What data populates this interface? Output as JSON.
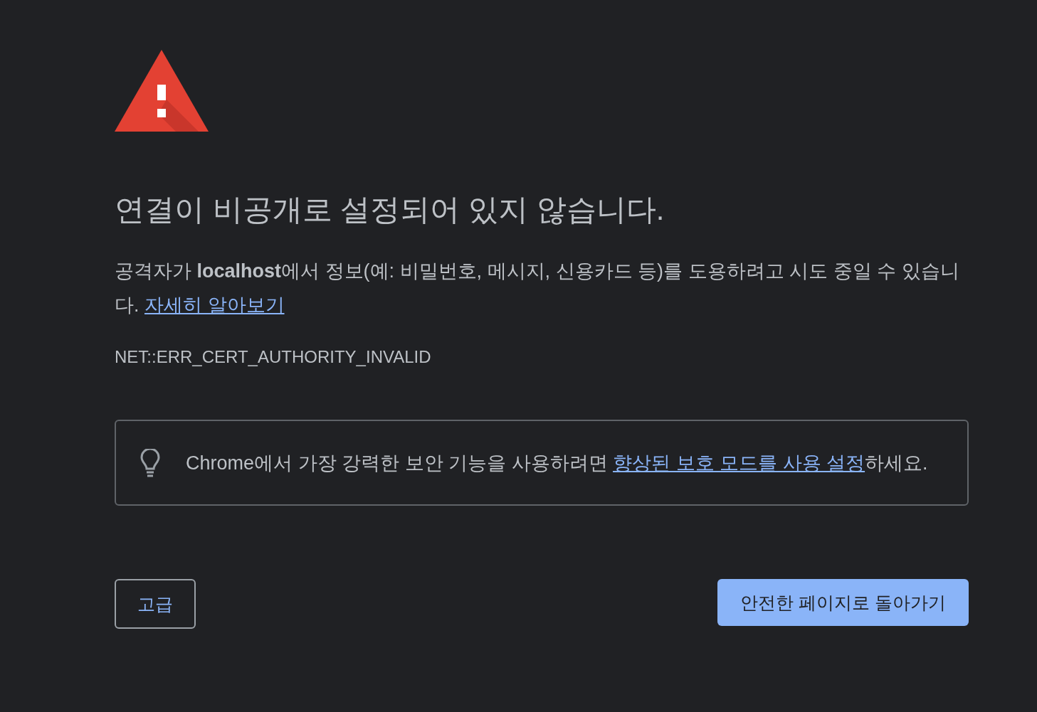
{
  "heading": "연결이 비공개로 설정되어 있지 않습니다.",
  "description": {
    "text": "공격자가 **localhost**에서 정보(예: 비밀번호, 메시지, 신용카드 등)를 도용하려고 시도 중일 수 있습니다.",
    "link": "자세히 알아보기"
  },
  "error_code": "NET::ERR_CERT_AUTHORITY_INVALID",
  "protection_tip": {
    "text_before": "Chrome에서 가장 강력한 보안 기능을 사용하려면 ",
    "link": "향상된 보호 모드를 사용 설정",
    "text_after": "하세요."
  },
  "buttons": [
    {
      "label": "고급",
      "kind": "secondary"
    },
    {
      "label": "안전한 페이지로 돌아가기",
      "kind": "primary"
    }
  ]
}
